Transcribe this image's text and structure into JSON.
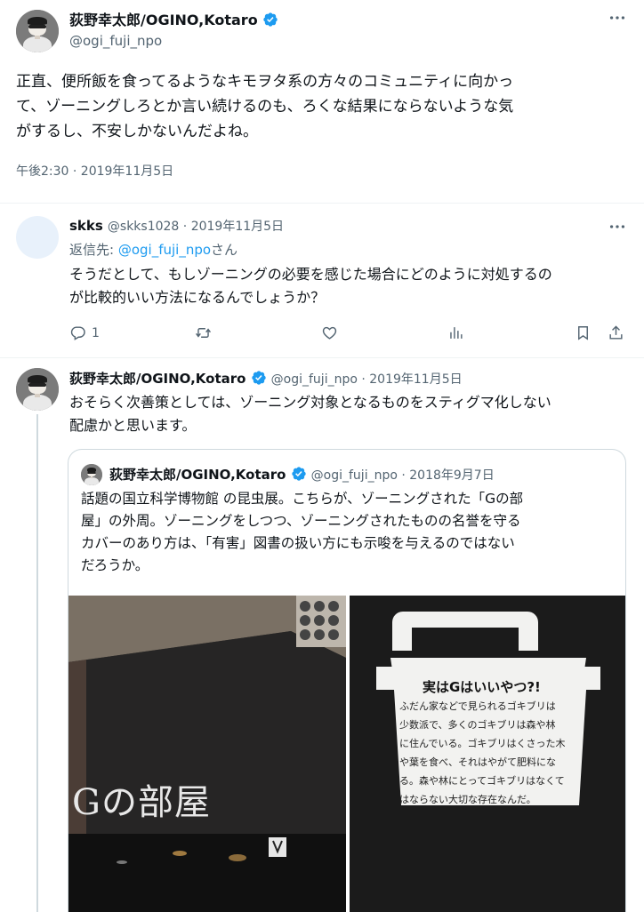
{
  "main_tweet": {
    "display_name": "荻野幸太郎/OGINO,Kotaro",
    "handle": "@ogi_fuji_npo",
    "text_lines": [
      "正直、便所飯を食ってるようなキモヲタ系の方々のコミュニティに向かっ",
      "て、ゾーニングしろとか言い続けるのも、ろくな結果にならないような気",
      "がするし、不安しかないんだよね。"
    ],
    "timestamp": "午後2:30 · 2019年11月5日"
  },
  "reply_1": {
    "display_name": "skks",
    "handle": "@skks1028",
    "date": " · 2019年11月5日",
    "reply_to_prefix": "返信先: ",
    "reply_to_handle": "@ogi_fuji_npo",
    "reply_to_suffix": "さん",
    "text_lines": [
      "そうだとして、もしゾーニングの必要を感じた場合にどのように対処するの",
      "が比較的いい方法になるんでしょうか？"
    ],
    "reply_count": "1"
  },
  "reply_2": {
    "display_name": "荻野幸太郎/OGINO,Kotaro",
    "handle_date": "@ogi_fuji_npo · 2019年11月5日",
    "text_lines": [
      "おそらく次善策としては、ゾーニング対象となるものをスティグマ化しない",
      "配慮かと思います。"
    ]
  },
  "quoted_tweet": {
    "display_name": "荻野幸太郎/OGINO,Kotaro",
    "handle_date": "@ogi_fuji_npo · 2018年9月7日",
    "text_lines": [
      "話題の国立科学博物館 の昆虫展。こちらが、ゾーニングされた「Gの部",
      "屋」の外周。ゾーニングをしつつ、ゾーニングされたものの名誉を守る",
      "カバーのあり方は、「有害」図書の扱い方にも示唆を与えるのではない",
      "だろうか。"
    ],
    "photo_left_sign": "Gの部屋",
    "card_title": "実はGはいいやつ?!",
    "card_lines": [
      "ふだん家などで見られるゴキブリは",
      "少数派で、多くのゴキブリは森や林",
      "に住んでいる。ゴキブリはくさった木",
      "や葉を食べ、それはやがて肥料にな",
      "る。森や林にとってゴキブリはなくて",
      "はならない大切な存在なんだ。"
    ]
  },
  "colors": {
    "accent": "#1d9bf0",
    "text": "#0f1419",
    "muted": "#536471",
    "divider": "#eff3f4"
  },
  "icons": [
    "more-icon",
    "verified-badge-icon",
    "reply-icon",
    "retweet-icon",
    "like-icon",
    "views-icon",
    "bookmark-icon",
    "share-icon"
  ]
}
